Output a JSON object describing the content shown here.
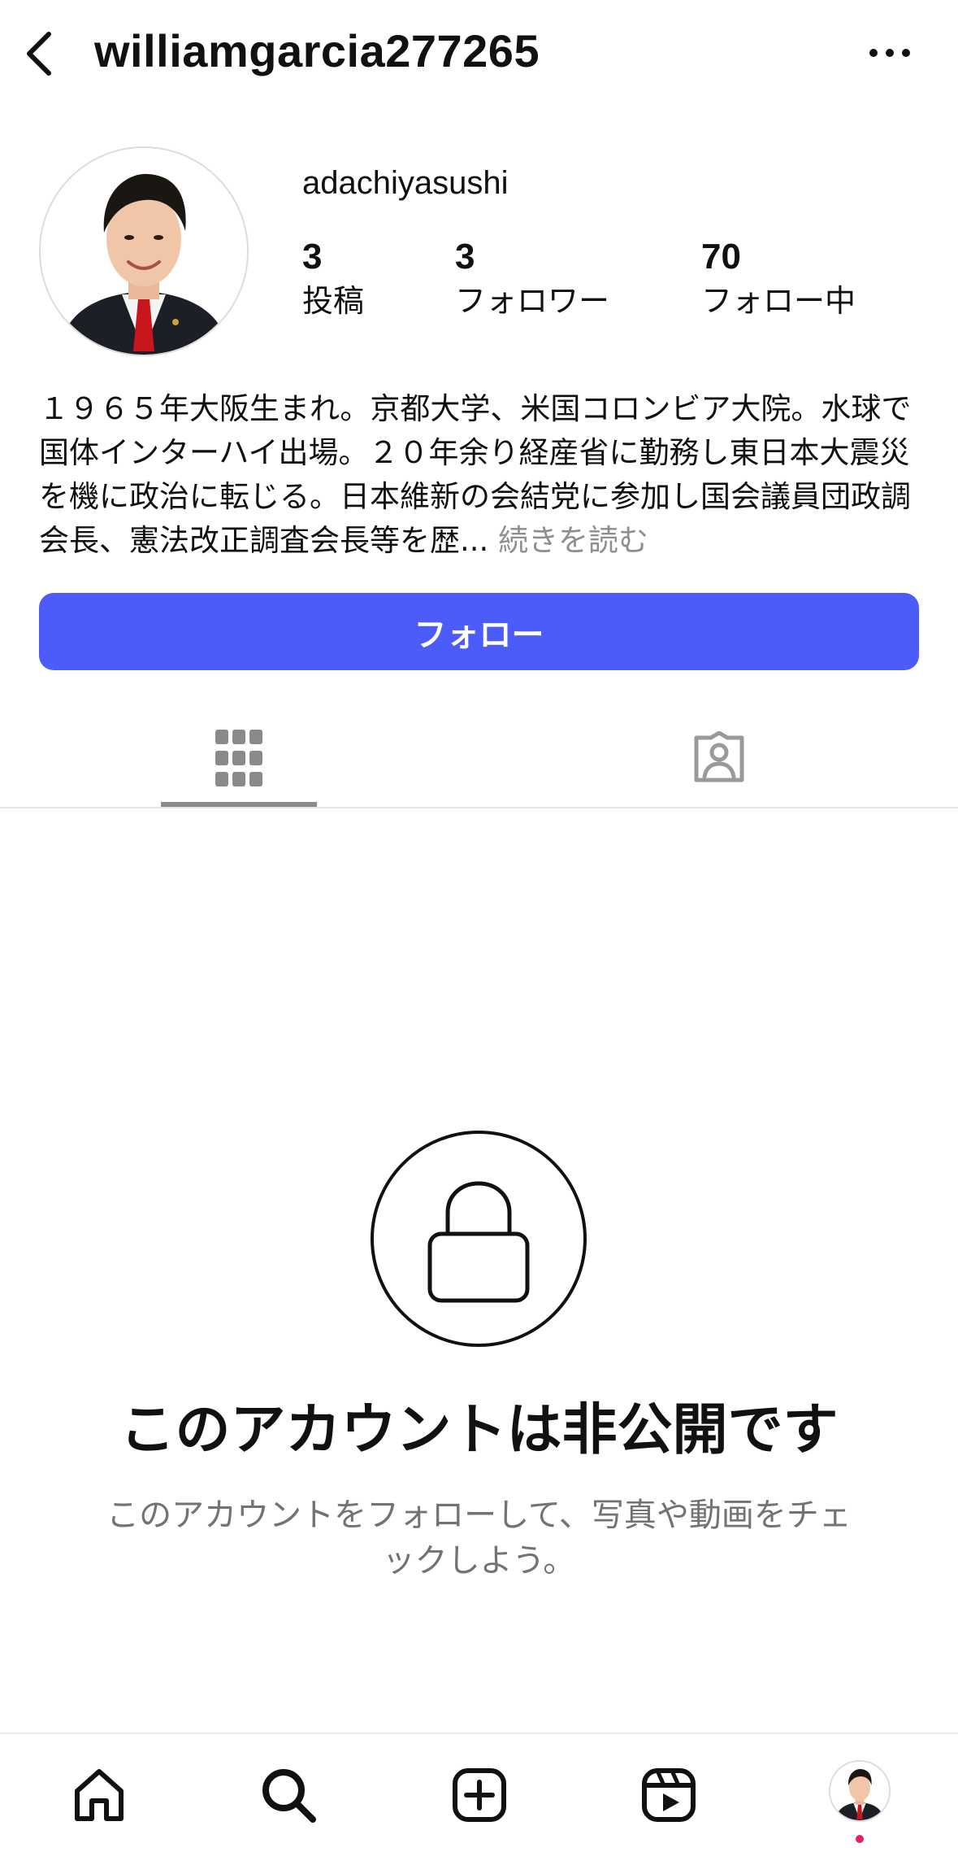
{
  "header": {
    "title": "williamgarcia277265",
    "back_icon": "chevron-left-icon",
    "more_icon": "more-horizontal-icon"
  },
  "profile": {
    "name": "adachiyasushi",
    "avatar": "profile-photo",
    "stats": [
      {
        "count": "3",
        "label": "投稿"
      },
      {
        "count": "3",
        "label": "フォロワー"
      },
      {
        "count": "70",
        "label": "フォロー中"
      }
    ],
    "bio_text": "１９６５年大阪生まれ。京都大学、米国コロンビア大院。水球で国体インターハイ出場。２０年余り経産省に勤務し東日本大震災を機に政治に転じる。日本維新の会結党に参加し国会議員団政調会長、憲法改正調査会長等を歴...",
    "bio_more": "続きを読む"
  },
  "follow_button": {
    "label": "フォロー",
    "color": "#4b5cf8"
  },
  "tabs": [
    {
      "icon": "grid-icon",
      "active": true
    },
    {
      "icon": "tagged-person-icon",
      "active": false
    }
  ],
  "private_notice": {
    "icon": "lock-icon",
    "title": "このアカウントは非公開です",
    "subtitle": "このアカウントをフォローして、写真や動画をチェックしよう。"
  },
  "bottom_nav": [
    {
      "icon": "home-icon"
    },
    {
      "icon": "search-icon"
    },
    {
      "icon": "create-post-icon"
    },
    {
      "icon": "reels-icon"
    },
    {
      "icon": "profile-avatar-icon",
      "notification_dot": "#e0245e"
    }
  ]
}
